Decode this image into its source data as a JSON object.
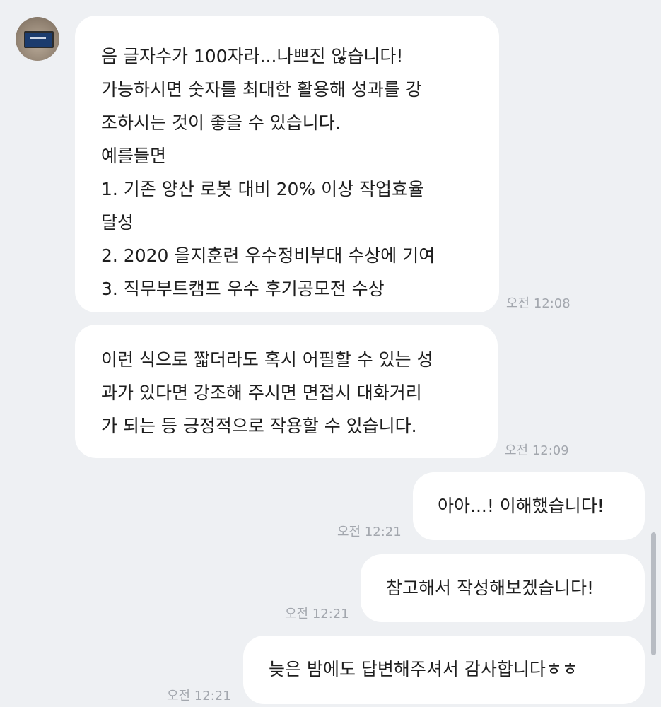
{
  "messages": [
    {
      "side": "incoming",
      "lines": [
        "음 글자수가 100자라...나쁘진 않습니다!",
        "가능하시면 숫자를 최대한 활용해 성과를 강",
        "조하시는 것이 좋을 수 있습니다.",
        "예를들면",
        "1. 기존 양산 로봇 대비 20% 이상 작업효율",
        "달성",
        "2. 2020 을지훈련 우수정비부대 수상에 기여",
        "3. 직무부트캠프 우수 후기공모전 수상"
      ],
      "time": "오전 12:08"
    },
    {
      "side": "incoming",
      "lines": [
        "이런 식으로 짧더라도 혹시 어필할 수 있는 성",
        "과가 있다면 강조해 주시면 면접시 대화거리",
        "가 되는 등 긍정적으로 작용할 수 있습니다."
      ],
      "time": "오전 12:09"
    },
    {
      "side": "outgoing",
      "lines": [
        "아아...! 이해했습니다!"
      ],
      "time": "오전 12:21"
    },
    {
      "side": "outgoing",
      "lines": [
        "참고해서 작성해보겠습니다!"
      ],
      "time": "오전 12:21"
    },
    {
      "side": "outgoing",
      "lines": [
        "늦은 밤에도 답변해주셔서 감사합니다ㅎㅎ"
      ],
      "time": "오전 12:21"
    }
  ],
  "avatar": {
    "icon": "profile-photo-icon"
  },
  "colors": {
    "background": "#eef0f3",
    "bubble": "#ffffff",
    "text": "#1e1e1e",
    "timestamp": "#a3a7ae"
  }
}
